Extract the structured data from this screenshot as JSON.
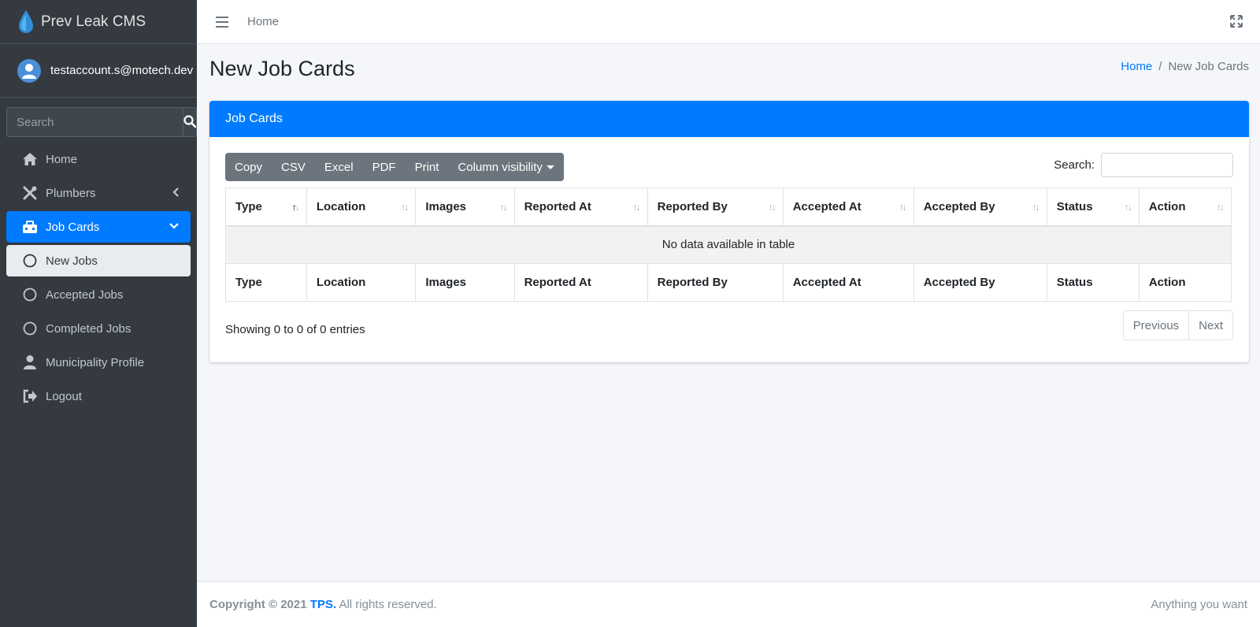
{
  "brand": {
    "name": "Prev Leak CMS"
  },
  "user": {
    "email": "testaccount.s@motech.dev"
  },
  "sidebar_search": {
    "placeholder": "Search"
  },
  "nav": [
    {
      "label": "Home",
      "icon": "home-icon"
    },
    {
      "label": "Plumbers",
      "icon": "tools-icon"
    },
    {
      "label": "Job Cards",
      "icon": "toolbox-icon"
    },
    {
      "label": "New Jobs",
      "icon": "circle-icon"
    },
    {
      "label": "Accepted Jobs",
      "icon": "circle-icon"
    },
    {
      "label": "Completed Jobs",
      "icon": "circle-icon"
    },
    {
      "label": "Municipality Profile",
      "icon": "user-icon"
    },
    {
      "label": "Logout",
      "icon": "sign-out-icon"
    }
  ],
  "topbar": {
    "home_link": "Home"
  },
  "page": {
    "title": "New Job Cards"
  },
  "breadcrumb": {
    "home": "Home",
    "current": "New Job Cards",
    "separator": "/"
  },
  "card": {
    "title": "Job Cards"
  },
  "toolbar": {
    "copy": "Copy",
    "csv": "CSV",
    "excel": "Excel",
    "pdf": "PDF",
    "print": "Print",
    "column_visibility": "Column visibility"
  },
  "table": {
    "search_label": "Search:",
    "columns": [
      "Type",
      "Location",
      "Images",
      "Reported At",
      "Reported By",
      "Accepted At",
      "Accepted By",
      "Status",
      "Action"
    ],
    "empty_message": "No data available in table",
    "info": "Showing 0 to 0 of 0 entries",
    "pager": {
      "previous": "Previous",
      "next": "Next"
    }
  },
  "footer": {
    "copyright": "Copyright © 2021",
    "company": "TPS.",
    "rights": "All rights reserved.",
    "right_text": "Anything you want"
  },
  "colors": {
    "primary": "#007bff",
    "sidebar": "#343a40",
    "secondary": "#6c757d"
  }
}
